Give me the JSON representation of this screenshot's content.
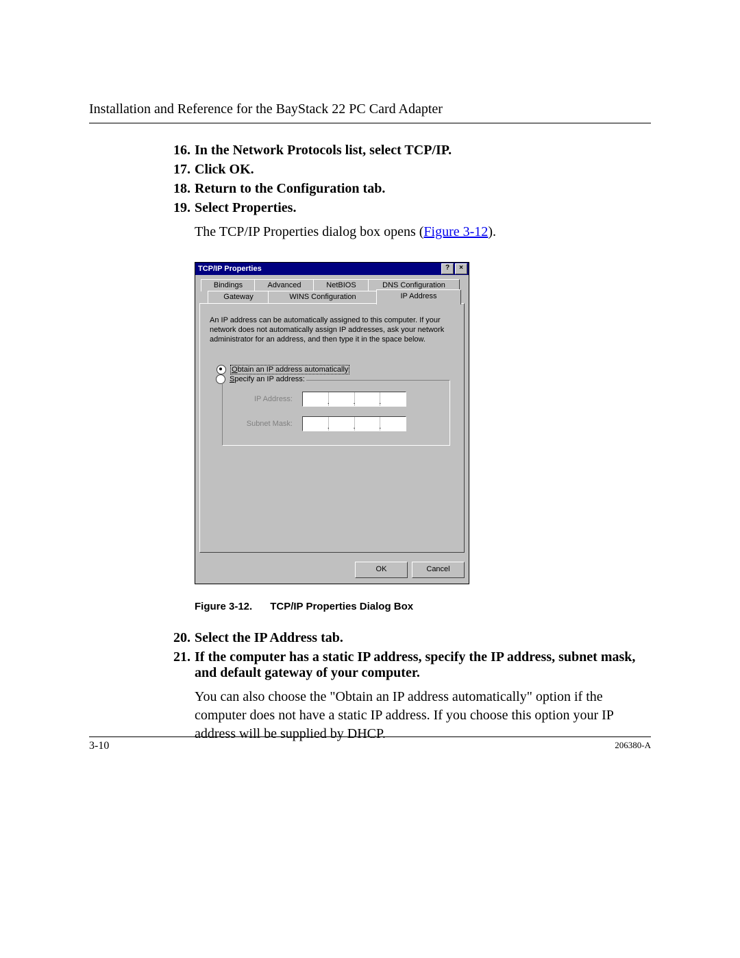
{
  "header": "Installation and Reference for the BayStack 22 PC Card Adapter",
  "steps_a": [
    {
      "n": "16.",
      "t": "In the Network Protocols list, select TCP/IP."
    },
    {
      "n": "17.",
      "t": "Click OK."
    },
    {
      "n": "18.",
      "t": "Return to the Configuration tab."
    },
    {
      "n": "19.",
      "t": "Select Properties."
    }
  ],
  "para1_a": "The TCP/IP Properties dialog box opens (",
  "para1_link": "Figure 3-12",
  "para1_b": ").",
  "dialog": {
    "title": "TCP/IP Properties",
    "help": "?",
    "close": "×",
    "tabs_back": [
      "Bindings",
      "Advanced",
      "NetBIOS",
      "DNS Configuration"
    ],
    "tabs_front": [
      "Gateway",
      "WINS Configuration",
      "IP Address"
    ],
    "desc": "An IP address can be automatically assigned to this computer. If your network does not automatically assign IP addresses, ask your network administrator for an address, and then type it in the space below.",
    "radio_auto_pre": "O",
    "radio_auto_rest": "btain an IP address automatically",
    "radio_spec_pre": "S",
    "radio_spec_rest": "pecify an IP address:",
    "ip_label": "IP Address:",
    "mask_label": "Subnet Mask:",
    "ok": "OK",
    "cancel": "Cancel"
  },
  "caption_num": "Figure 3-12.",
  "caption_txt": "TCP/IP Properties Dialog Box",
  "steps_b": [
    {
      "n": "20.",
      "t": "Select the IP Address tab."
    },
    {
      "n": "21.",
      "t": "If the computer has a static IP address, specify the IP address, subnet mask, and default gateway of your computer."
    }
  ],
  "para2": "You can also choose the \"Obtain an IP address automatically\" option if the computer does not have a static IP address. If you choose this option your IP address will be supplied by DHCP.",
  "footer_page": "3-10",
  "footer_doc": "206380-A"
}
